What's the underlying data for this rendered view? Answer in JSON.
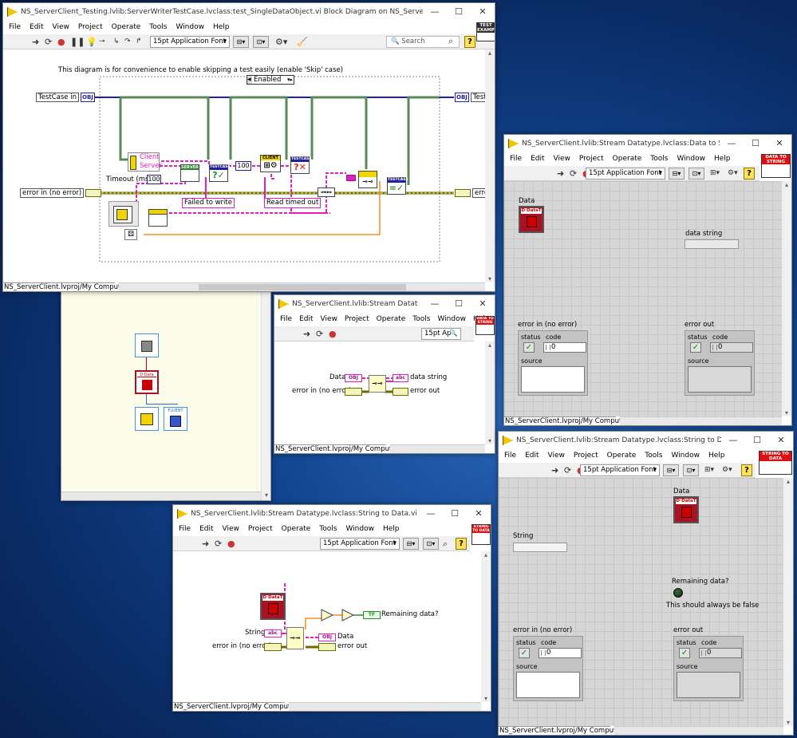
{
  "menu": [
    "File",
    "Edit",
    "View",
    "Project",
    "Operate",
    "Tools",
    "Window",
    "Help"
  ],
  "font_selector": "15pt Application Font",
  "font_selector_short": "15pt Ap",
  "statusbar": "NS_ServerClient.lvproj/My Computer",
  "w1": {
    "title": "NS_ServerClient_Testing.lvlib:ServerWriterTestCase.lvclass:test_SingleDataObject.vi Block Diagram on NS_ServerClient.lvproj/My Computer",
    "search_placeholder": "Search",
    "icon_text": "TEST EXAMPLE",
    "comment": "This diagram is for convenience to enable skipping a test easily (enable 'Skip' case)",
    "case_selector": "Enabled",
    "testcase_in": "TestCase in",
    "testcase_out": "Test",
    "error_in": "error in (no error)",
    "error_out": "error",
    "timeout_label": "Timeout (ms)",
    "timeout_value": "100",
    "loop_const": "100",
    "client": "Client",
    "server": "Server",
    "failed_to_write": "Failed to write",
    "read_timed_out": "Read timed out",
    "server_write_node": "SERVER WRITE DATA",
    "client_node": "CLIENT",
    "testcase_node": "TESTCASE",
    "obj_tag": "OBJ",
    "fluent_tag": "FLUENT"
  },
  "w2": {
    "title": "NS_ServerClient.lvlib:Stream Datatype.lvclass:Data to String.vi Fr...",
    "icon_text": "DATA TO STRING",
    "data_label": "Data",
    "data_string_label": "data string",
    "error_in_label": "error in (no error)",
    "error_out_label": "error out",
    "status": "status",
    "code": "code",
    "source": "source",
    "code_in": "0",
    "code_out": "0"
  },
  "w3": {
    "title": "NS_ServerClient.lvlib:Stream Datatype.lvcl...",
    "icon_text": "DATA TO STRING",
    "data_label": "Data",
    "error_in_label": "error in (no error)",
    "data_string_label": "data string",
    "error_out_label": "error out"
  },
  "w4": {
    "title": "NS_ServerClient.lvlib:Stream Datatype.lvclass:String to Data.vi Block Diagra...",
    "icon_text": "STRING TO DATA",
    "string_label": "String",
    "error_in_label": "error in (no error)",
    "data_label": "Data",
    "error_out_label": "error out",
    "remaining_label": "Remaining data?",
    "tf_tag": "TF"
  },
  "w5": {
    "title": "NS_ServerClient.lvlib:Stream Datatype.lvclass:String to Data.vi Fron...",
    "icon_text": "STRING TO DATA",
    "data_label": "Data",
    "string_label": "String",
    "remaining_label": "Remaining data?",
    "remaining_note": "This should always be false",
    "error_in_label": "error in (no error)",
    "error_out_label": "error out",
    "status": "status",
    "code": "code",
    "source": "source",
    "code_in": "0",
    "code_out": "0"
  },
  "colors": {
    "object_wire": "#e020c0",
    "error_wire": "#6b6b00",
    "class_wire": "#2020a0",
    "loop_frame": "#5a8a5a",
    "orange_wire": "#ff8c1a"
  }
}
